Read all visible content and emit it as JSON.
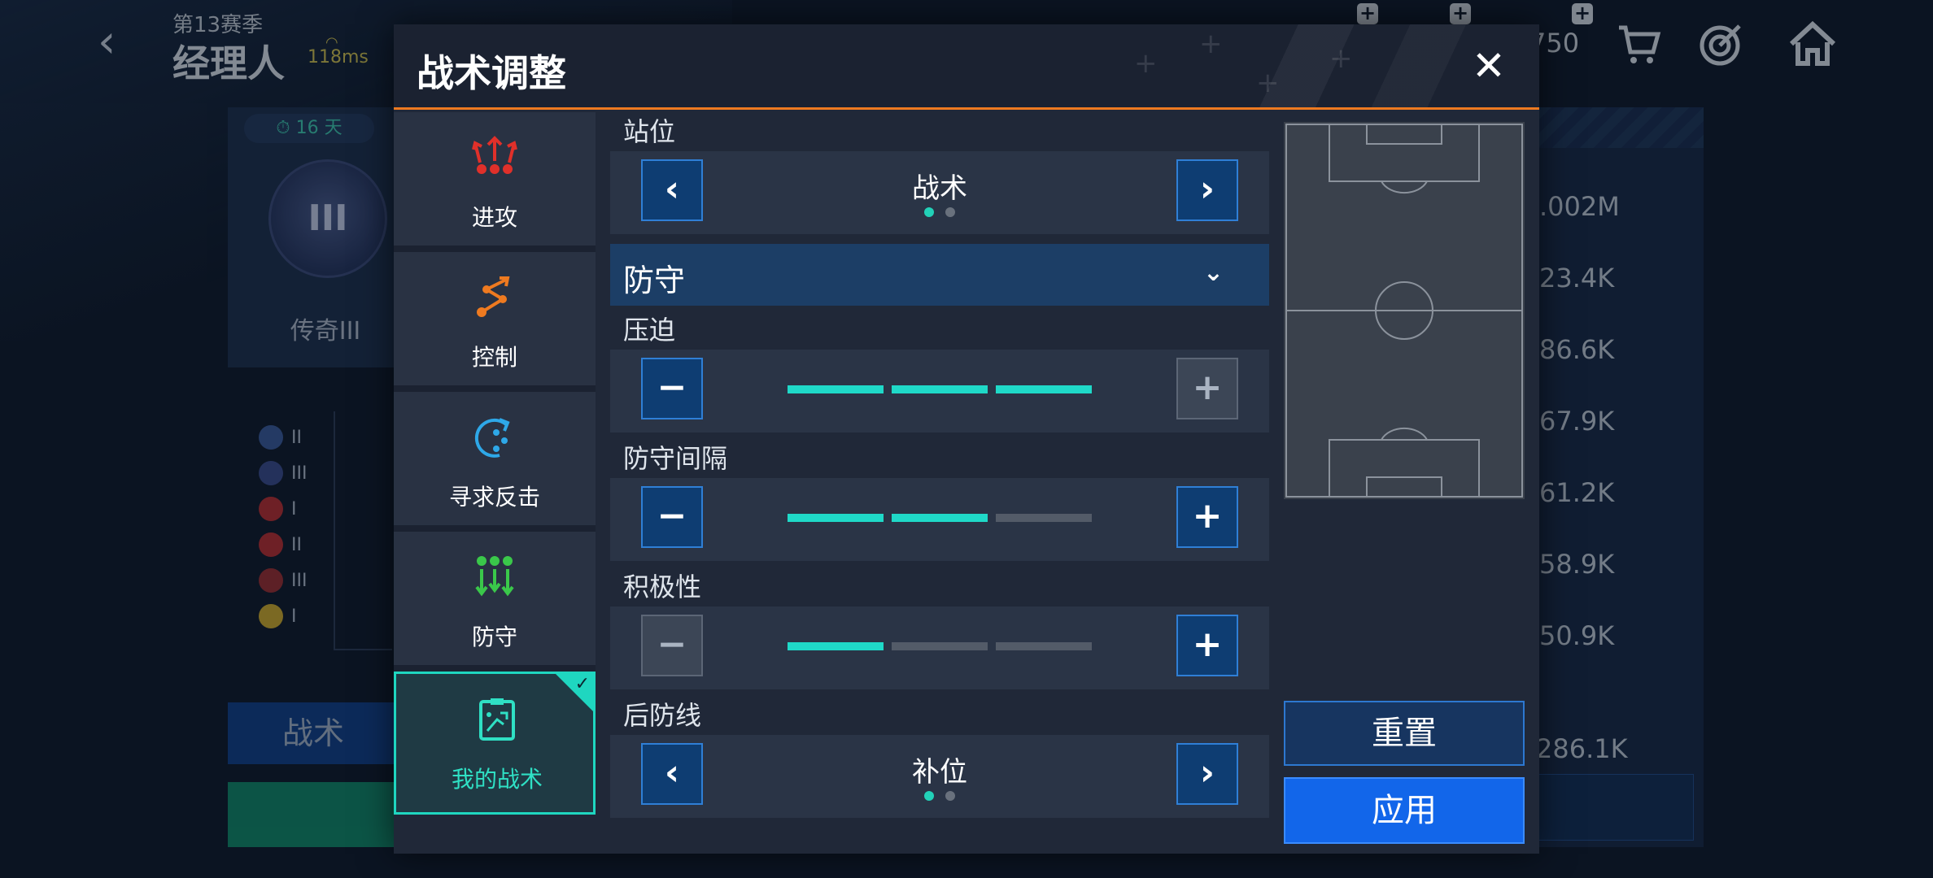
{
  "background": {
    "season": "第13赛季",
    "mode_title": "经理人",
    "ping": "118ms",
    "coins": "750",
    "timer": "16 天",
    "rank_label": "传奇III",
    "rank_numeral": "III",
    "legend": [
      {
        "numeral": "II",
        "color": "#3a5a9a"
      },
      {
        "numeral": "III",
        "color": "#3a4a8a"
      },
      {
        "numeral": "I",
        "color": "#c02a2a"
      },
      {
        "numeral": "II",
        "color": "#c02a2a"
      },
      {
        "numeral": "III",
        "color": "#a02a2a"
      },
      {
        "numeral": "I",
        "color": "#d8b024"
      }
    ],
    "tab_tactics": "战术",
    "right_values": [
      ".002M",
      "23.4K",
      "86.6K",
      "67.9K",
      "61.2K",
      "58.9K",
      "50.9K"
    ],
    "right_value_small": "286.1K"
  },
  "modal": {
    "title": "战术调整",
    "close_glyph": "✕",
    "nav": [
      {
        "label": "进攻",
        "icon": "attack-icon",
        "color": "#e0302a",
        "active": false
      },
      {
        "label": "控制",
        "icon": "control-icon",
        "color": "#ee7a20",
        "active": false
      },
      {
        "label": "寻求反击",
        "icon": "counter-attack-icon",
        "color": "#2ea8e8",
        "active": false
      },
      {
        "label": "防守",
        "icon": "defense-icon",
        "color": "#3ac84a",
        "active": false
      },
      {
        "label": "我的战术",
        "icon": "my-tactics-icon",
        "color": "#2fe0c4",
        "active": true
      }
    ],
    "formation": {
      "label": "站位",
      "value": "战术",
      "page": 1,
      "pages": 2
    },
    "section": {
      "label": "防守",
      "chevron": "⌄"
    },
    "sliders": [
      {
        "label": "压迫",
        "level": 3,
        "max": 3,
        "minus_enabled": true,
        "plus_enabled": false
      },
      {
        "label": "防守间隔",
        "level": 2,
        "max": 3,
        "minus_enabled": true,
        "plus_enabled": true
      },
      {
        "label": "积极性",
        "level": 1,
        "max": 3,
        "minus_enabled": false,
        "plus_enabled": true
      }
    ],
    "backline": {
      "label": "后防线",
      "value": "补位",
      "page": 1,
      "pages": 2
    },
    "buttons": {
      "prev_glyph": "‹",
      "next_glyph": "›",
      "minus_glyph": "−",
      "plus_glyph": "+",
      "reset": "重置",
      "apply": "应用"
    },
    "colors": {
      "accent_orange": "#ee7a20",
      "accent_teal": "#1fd9c8",
      "primary_blue": "#1266ea"
    }
  }
}
